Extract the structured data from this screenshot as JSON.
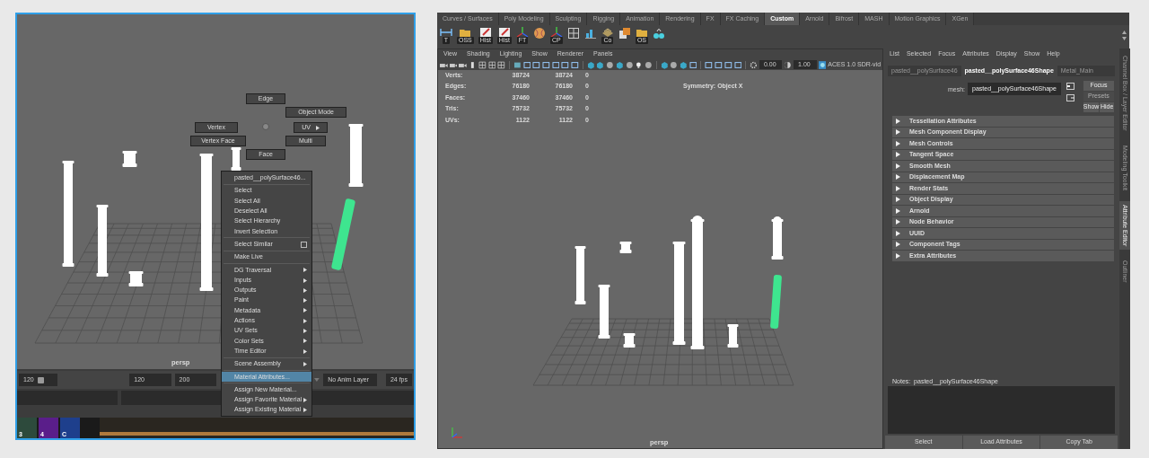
{
  "left_window": {
    "viewport": {
      "camera": "persp"
    },
    "marking_menu": [
      {
        "label": "Edge",
        "submenu": false
      },
      {
        "label": "Object Mode",
        "submenu": false
      },
      {
        "label": "Vertex",
        "submenu": false
      },
      {
        "label": "UV",
        "submenu": true
      },
      {
        "label": "Vertex Face",
        "submenu": false
      },
      {
        "label": "Multi",
        "submenu": false
      },
      {
        "label": "Face",
        "submenu": false
      }
    ],
    "context_menu": {
      "title": "pasted__polySurface46...",
      "sections": [
        [
          {
            "label": "Select",
            "submenu": false,
            "option_box": false,
            "selected": false
          },
          {
            "label": "Select All",
            "submenu": false,
            "option_box": false,
            "selected": false
          },
          {
            "label": "Deselect All",
            "submenu": false,
            "option_box": false,
            "selected": false
          },
          {
            "label": "Select Hierarchy",
            "submenu": false,
            "option_box": false,
            "selected": false
          },
          {
            "label": "Invert Selection",
            "submenu": false,
            "option_box": false,
            "selected": false
          }
        ],
        [
          {
            "label": "Select Similar",
            "submenu": false,
            "option_box": true,
            "selected": false
          }
        ],
        [
          {
            "label": "Make Live",
            "submenu": false,
            "option_box": false,
            "selected": false
          }
        ],
        [
          {
            "label": "DG Traversal",
            "submenu": true,
            "option_box": false,
            "selected": false
          },
          {
            "label": "Inputs",
            "submenu": true,
            "option_box": false,
            "selected": false
          },
          {
            "label": "Outputs",
            "submenu": true,
            "option_box": false,
            "selected": false
          },
          {
            "label": "Paint",
            "submenu": true,
            "option_box": false,
            "selected": false
          },
          {
            "label": "Metadata",
            "submenu": true,
            "option_box": false,
            "selected": false
          },
          {
            "label": "Actions",
            "submenu": true,
            "option_box": false,
            "selected": false
          },
          {
            "label": "UV Sets",
            "submenu": true,
            "option_box": false,
            "selected": false
          },
          {
            "label": "Color Sets",
            "submenu": true,
            "option_box": false,
            "selected": false
          },
          {
            "label": "Time Editor",
            "submenu": true,
            "option_box": false,
            "selected": false
          }
        ],
        [
          {
            "label": "Scene Assembly",
            "submenu": true,
            "option_box": false,
            "selected": false
          }
        ],
        [
          {
            "label": "Material Attributes...",
            "submenu": false,
            "option_box": false,
            "selected": true
          }
        ],
        [
          {
            "label": "Assign New Material...",
            "submenu": false,
            "option_box": false,
            "selected": false
          },
          {
            "label": "Assign Favorite Material",
            "submenu": true,
            "option_box": false,
            "selected": false
          },
          {
            "label": "Assign Existing Material",
            "submenu": true,
            "option_box": false,
            "selected": false
          }
        ]
      ]
    },
    "range_bar": {
      "start": "120",
      "current": "120",
      "end": "200",
      "anim_layer": "No Anim Layer",
      "fps": "24 fps"
    },
    "thumbnails": [
      {
        "label": "3"
      },
      {
        "label": "4"
      },
      {
        "label": "C"
      }
    ]
  },
  "right_window": {
    "shelf": {
      "tabs": [
        {
          "label": "Curves / Surfaces",
          "selected": false
        },
        {
          "label": "Poly Modeling",
          "selected": false
        },
        {
          "label": "Sculpting",
          "selected": false
        },
        {
          "label": "Rigging",
          "selected": false
        },
        {
          "label": "Animation",
          "selected": false
        },
        {
          "label": "Rendering",
          "selected": false
        },
        {
          "label": "FX",
          "selected": false
        },
        {
          "label": "FX Caching",
          "selected": false
        },
        {
          "label": "Custom",
          "selected": true
        },
        {
          "label": "Arnold",
          "selected": false
        },
        {
          "label": "Bifrost",
          "selected": false
        },
        {
          "label": "MASH",
          "selected": false
        },
        {
          "label": "Motion Graphics",
          "selected": false
        },
        {
          "label": "XGen",
          "selected": false
        }
      ],
      "button_labels": [
        "T",
        "OSS",
        "Hist",
        "Hist",
        "FT",
        "CP",
        "Co",
        "OS"
      ]
    },
    "viewport": {
      "menus": [
        "View",
        "Shading",
        "Lighting",
        "Show",
        "Renderer",
        "Panels"
      ],
      "exposure": "0.00",
      "gamma": "1.00",
      "color_space": "ACES 1.0 SDR-vid",
      "hud": {
        "rows": [
          {
            "label": "Verts:",
            "values": [
              "38724",
              "38724",
              "0"
            ]
          },
          {
            "label": "Edges:",
            "values": [
              "76180",
              "76180",
              "0"
            ]
          },
          {
            "label": "Faces:",
            "values": [
              "37460",
              "37460",
              "0"
            ]
          },
          {
            "label": "Tris:",
            "values": [
              "75732",
              "75732",
              "0"
            ]
          },
          {
            "label": "UVs:",
            "values": [
              "1122",
              "1122",
              "0"
            ]
          }
        ],
        "symmetry": "Symmetry: Object X"
      },
      "camera": "persp"
    },
    "attribute_editor": {
      "menus": [
        "List",
        "Selected",
        "Focus",
        "Attributes",
        "Display",
        "Show",
        "Help"
      ],
      "tabs": [
        {
          "label": "pasted__polySurface46",
          "selected": false
        },
        {
          "label": "pasted__polySurface46Shape",
          "selected": true
        },
        {
          "label": "Metal_Main",
          "selected": false
        }
      ],
      "node_label": "mesh:",
      "node_name": "pasted__polySurface46Shape",
      "buttons": [
        {
          "label": "Focus",
          "disabled": false
        },
        {
          "label": "Presets",
          "disabled": true
        },
        {
          "label": "Show",
          "disabled": false
        },
        {
          "label": "Hide",
          "disabled": false
        }
      ],
      "sections": [
        {
          "label": "Tessellation Attributes",
          "expanded": false
        },
        {
          "label": "Mesh Component Display",
          "expanded": false
        },
        {
          "label": "Mesh Controls",
          "expanded": false
        },
        {
          "label": "Tangent Space",
          "expanded": false
        },
        {
          "label": "Smooth Mesh",
          "expanded": false
        },
        {
          "label": "Displacement Map",
          "expanded": false
        },
        {
          "label": "Render Stats",
          "expanded": false
        },
        {
          "label": "Object Display",
          "expanded": false
        },
        {
          "label": "Arnold",
          "expanded": false
        },
        {
          "label": "Node Behavior",
          "expanded": false
        },
        {
          "label": "UUID",
          "expanded": false
        },
        {
          "label": "Component Tags",
          "expanded": false
        },
        {
          "label": "Extra Attributes",
          "expanded": false
        }
      ],
      "notes_label": "Notes:  pasted__polySurface46Shape",
      "footer_buttons": [
        "Select",
        "Load Attributes",
        "Copy Tab"
      ]
    },
    "side_tabs": [
      {
        "label": "Channel Box / Layer Editor",
        "selected": false
      },
      {
        "label": "Modeling Toolkit",
        "selected": false
      },
      {
        "label": "Attribute Editor",
        "selected": true
      },
      {
        "label": "Outliner",
        "selected": false
      }
    ]
  }
}
